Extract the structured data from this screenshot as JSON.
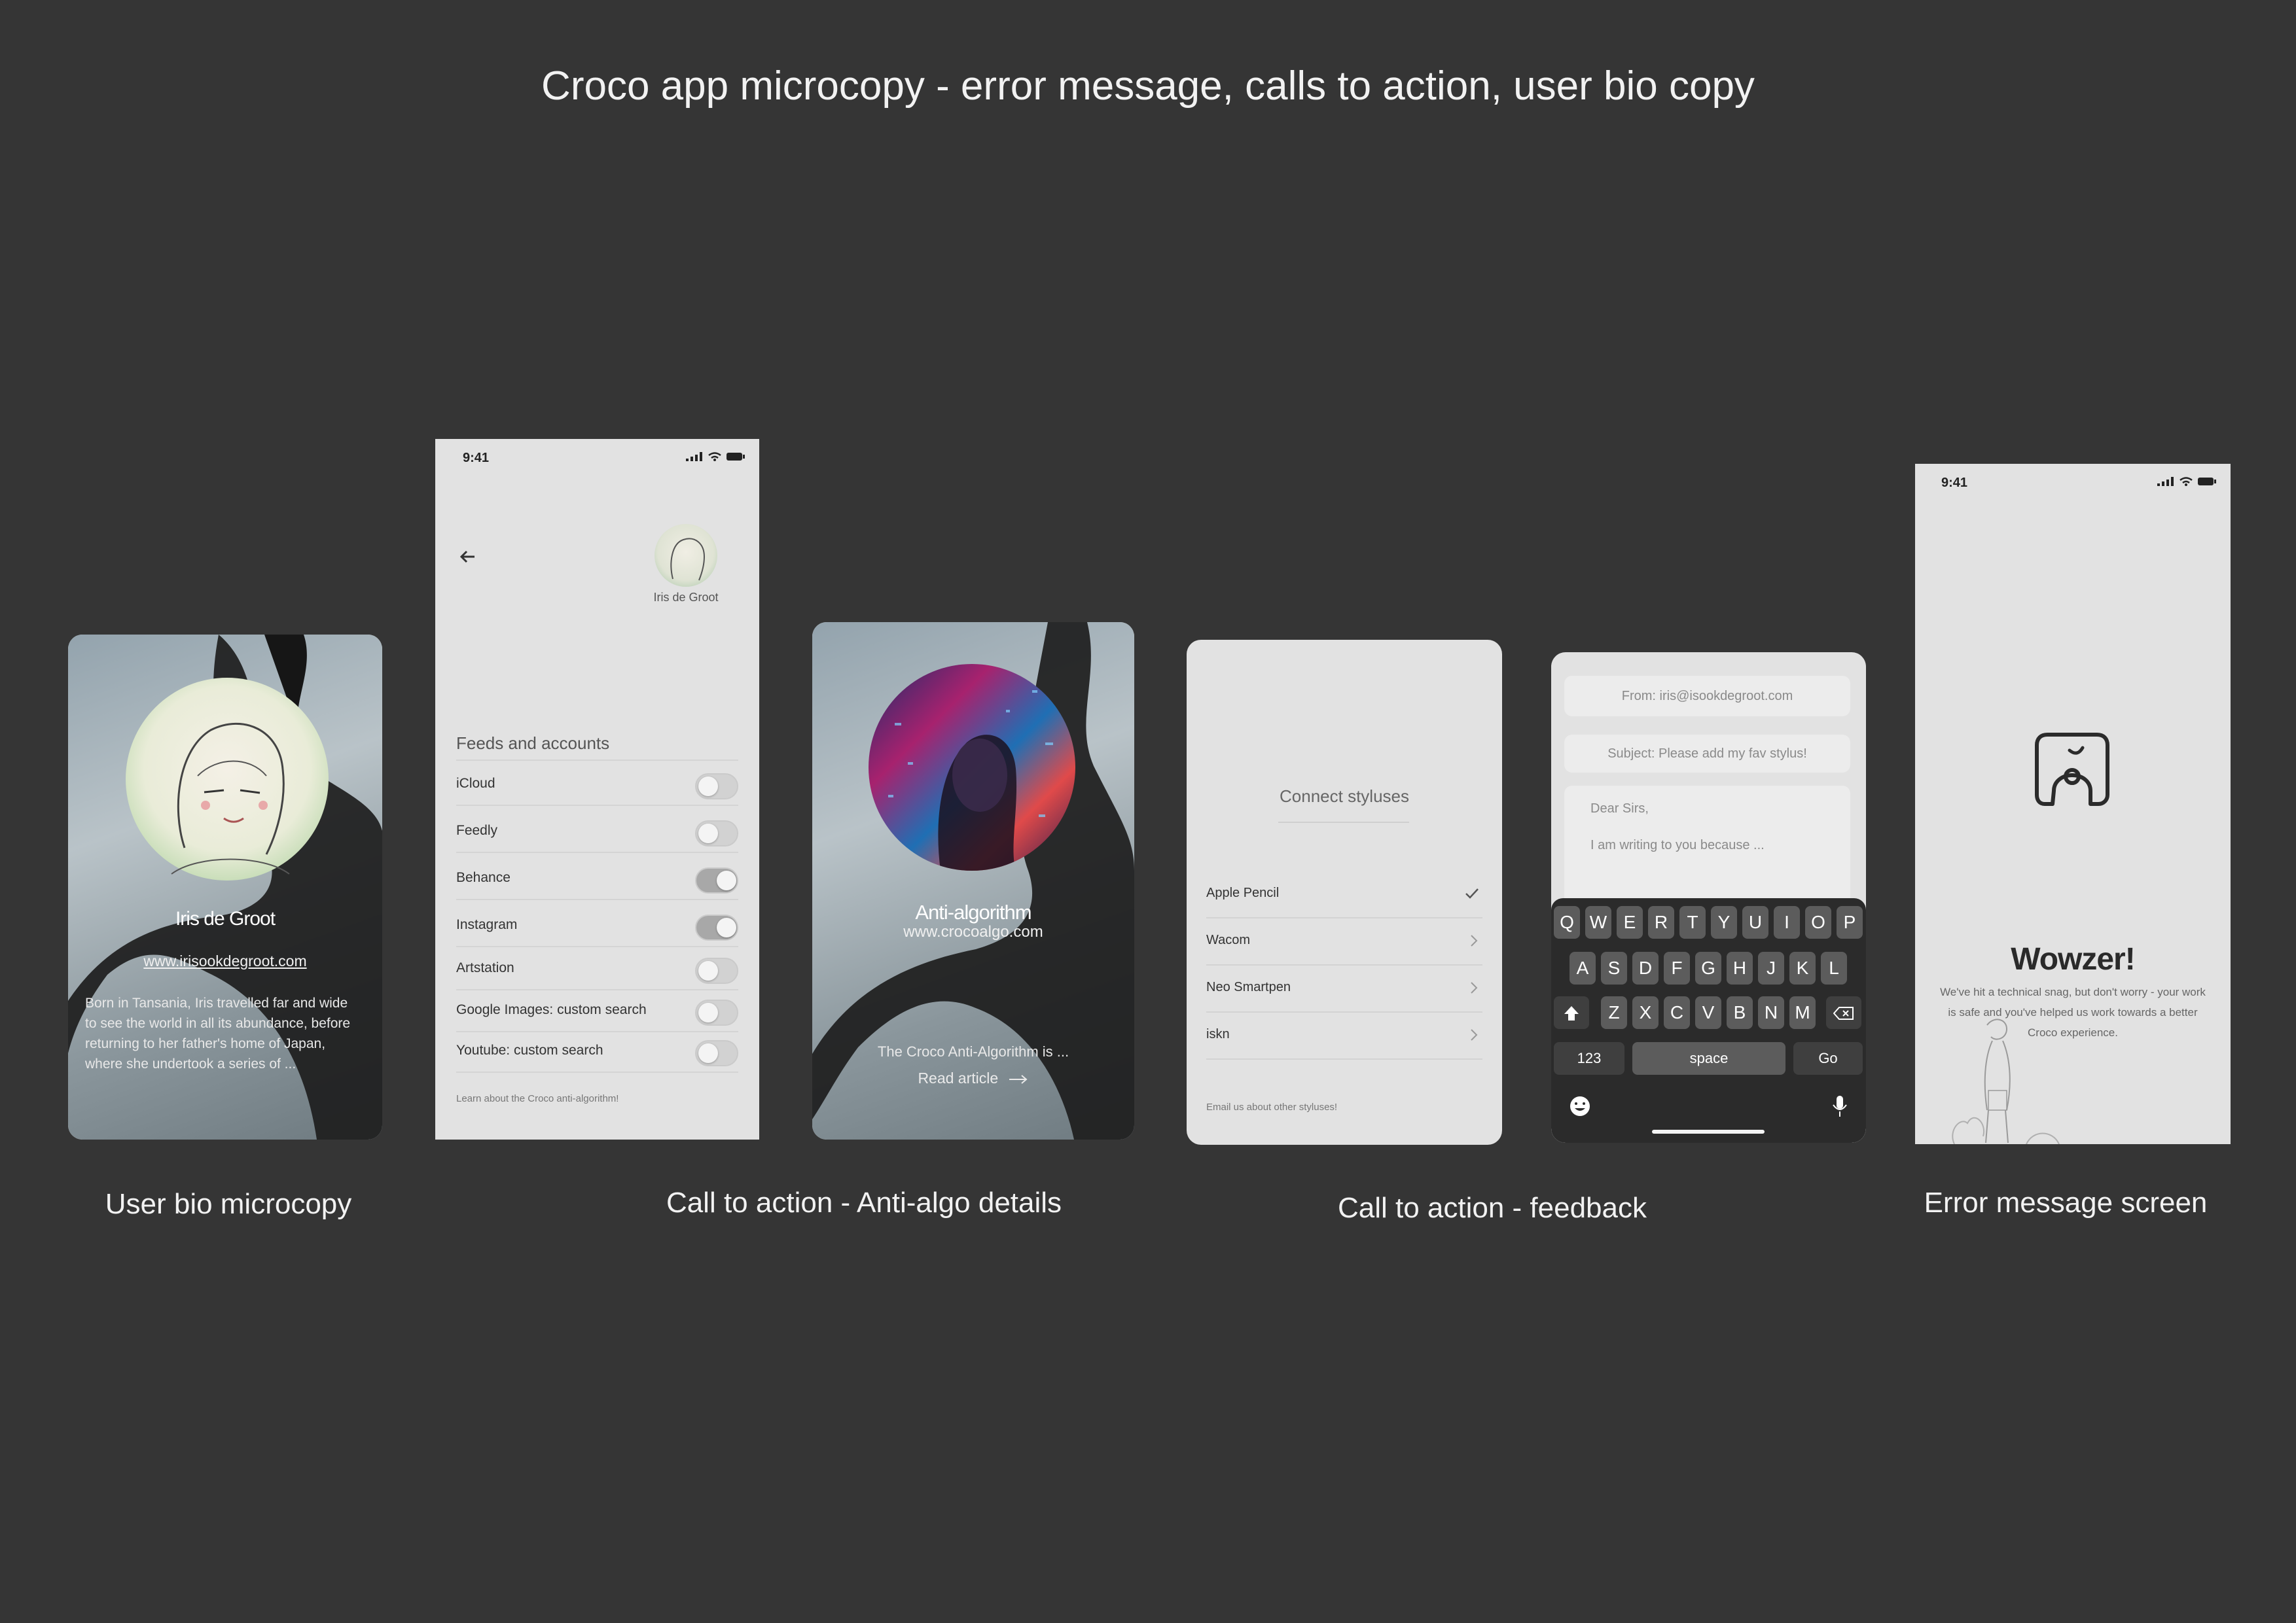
{
  "page": {
    "title": "Croco app microcopy - error message, calls to action, user bio copy",
    "captions": {
      "bio": "User bio microcopy",
      "antialgo": "Call to action - Anti-algo details",
      "feedback": "Call to action - feedback",
      "error": "Error message screen"
    }
  },
  "bio_card": {
    "name": "Iris de Groot",
    "url": "www.irisookdegroot.com",
    "bio": "Born in Tansania, Iris travelled far and wide to see the world in all its abundance, before returning to her father's home of Japan, where she undertook a series of ..."
  },
  "feeds_screen": {
    "time": "9:41",
    "back_icon": "arrow-left-icon",
    "profile_name": "Iris de Groot",
    "section_title": "Feeds and accounts",
    "items": [
      {
        "label": "iCloud",
        "on": false
      },
      {
        "label": "Feedly",
        "on": false
      },
      {
        "label": "Behance",
        "on": true
      },
      {
        "label": "Instagram",
        "on": true
      },
      {
        "label": "Artstation",
        "on": false
      },
      {
        "label": "Google Images: custom search",
        "on": false
      },
      {
        "label": "Youtube: custom search",
        "on": false
      }
    ],
    "footer": "Learn about the Croco anti-algorithm!"
  },
  "antialgo_card": {
    "title": "Anti-algorithm",
    "url": "www.crocoalgo.com",
    "teaser": "The Croco Anti-Algorithm is ...",
    "cta": "Read article",
    "cta_icon": "arrow-right-icon"
  },
  "styluses_card": {
    "title": "Connect styluses",
    "items": [
      {
        "label": "Apple Pencil",
        "icon": "checkmark-icon"
      },
      {
        "label": "Wacom",
        "icon": "chevron-right-icon"
      },
      {
        "label": "Neo Smartpen",
        "icon": "chevron-right-icon"
      },
      {
        "label": "iskn",
        "icon": "chevron-right-icon"
      }
    ],
    "footer": "Email us about other styluses!"
  },
  "email_card": {
    "from": "From: iris@isookdegroot.com",
    "subject": "Subject: Please add my fav stylus!",
    "greeting": "Dear Sirs,",
    "body": "I am writing to you because ...",
    "keyboard": {
      "row1": [
        "Q",
        "W",
        "E",
        "R",
        "T",
        "Y",
        "U",
        "I",
        "O",
        "P"
      ],
      "row2": [
        "A",
        "S",
        "D",
        "F",
        "G",
        "H",
        "J",
        "K",
        "L"
      ],
      "row3": [
        "Z",
        "X",
        "C",
        "V",
        "B",
        "N",
        "M"
      ],
      "numbers": "123",
      "space": "space",
      "go": "Go"
    }
  },
  "error_screen": {
    "time": "9:41",
    "headline": "Wowzer!",
    "message": "We've hit a technical snag, but don't worry - your work is safe and you've helped us work towards a better Croco experience."
  }
}
